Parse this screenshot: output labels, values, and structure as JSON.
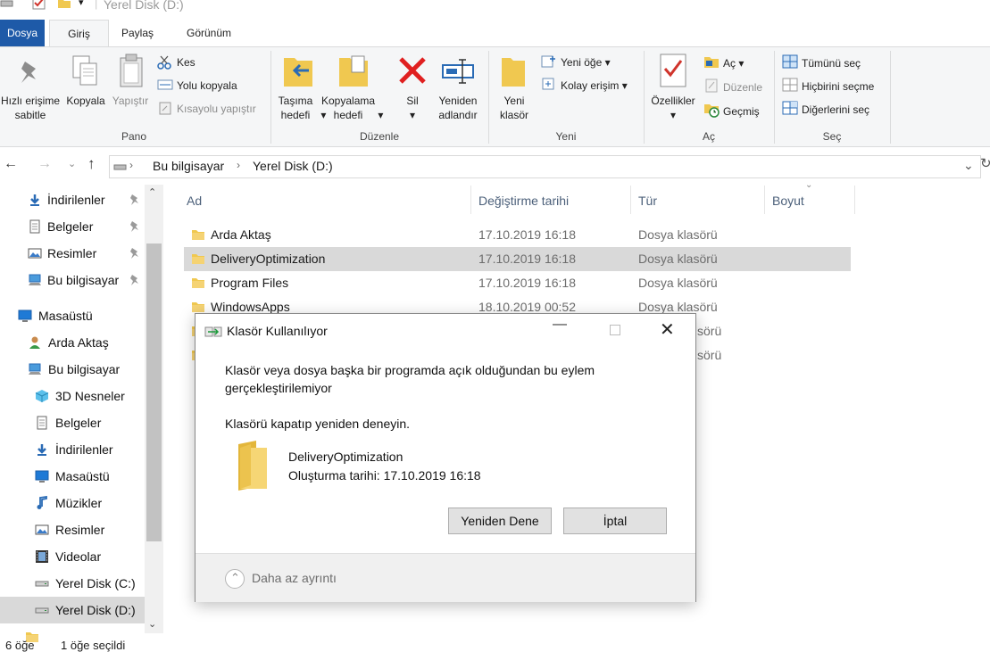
{
  "window": {
    "title": "Yerel Disk (D:)"
  },
  "tabs": [
    "Dosya",
    "Giriş",
    "Paylaş",
    "Görünüm"
  ],
  "ribbon": {
    "pano": {
      "label": "Pano",
      "pin": "Hızlı erişime sabitle",
      "copy": "Kopyala",
      "paste": "Yapıştır",
      "cut": "Kes",
      "copy_path": "Yolu kopyala",
      "paste_shortcut": "Kısayolu yapıştır"
    },
    "duzenle": {
      "label": "Düzenle",
      "move_to": "Taşıma hedefi",
      "copy_to": "Kopyalama hedefi",
      "delete": "Sil",
      "rename": "Yeniden adlandır"
    },
    "yeni": {
      "label": "Yeni",
      "new_folder": "Yeni klasör",
      "new_item": "Yeni öğe",
      "easy_access": "Kolay erişim"
    },
    "ac": {
      "label": "Aç",
      "properties": "Özellikler",
      "open": "Aç",
      "edit": "Düzenle",
      "history": "Geçmiş"
    },
    "sec": {
      "label": "Seç",
      "select_all": "Tümünü seç",
      "select_none": "Hiçbirini seçme",
      "invert": "Diğerlerini seç"
    }
  },
  "address": {
    "crumbs": [
      "Bu bilgisayar",
      "Yerel Disk (D:)"
    ]
  },
  "nav": {
    "quick": [
      {
        "label": "İndirilenler",
        "icon": "download-icon"
      },
      {
        "label": "Belgeler",
        "icon": "document-icon"
      },
      {
        "label": "Resimler",
        "icon": "pictures-icon"
      },
      {
        "label": "Bu bilgisayar",
        "icon": "computer-icon"
      }
    ],
    "tree": [
      {
        "label": "Masaüstü",
        "icon": "desktop-icon",
        "indent": 0
      },
      {
        "label": "Arda Aktaş",
        "icon": "user-icon",
        "indent": 1
      },
      {
        "label": "Bu bilgisayar",
        "icon": "computer-icon",
        "indent": 1
      },
      {
        "label": "3D Nesneler",
        "icon": "3d-objects-icon",
        "indent": 2
      },
      {
        "label": "Belgeler",
        "icon": "document-icon",
        "indent": 2
      },
      {
        "label": "İndirilenler",
        "icon": "download-icon",
        "indent": 2
      },
      {
        "label": "Masaüstü",
        "icon": "desktop-icon",
        "indent": 2
      },
      {
        "label": "Müzikler",
        "icon": "music-icon",
        "indent": 2
      },
      {
        "label": "Resimler",
        "icon": "pictures-icon",
        "indent": 2
      },
      {
        "label": "Videolar",
        "icon": "video-icon",
        "indent": 2
      },
      {
        "label": "Yerel Disk (C:)",
        "icon": "drive-icon",
        "indent": 2
      },
      {
        "label": "Yerel Disk (D:)",
        "icon": "drive-icon",
        "indent": 2,
        "selected": true
      }
    ]
  },
  "columns": [
    "Ad",
    "Değiştirme tarihi",
    "Tür",
    "Boyut"
  ],
  "files": [
    {
      "name": "Arda Aktaş",
      "date": "17.10.2019 16:18",
      "type": "Dosya klasörü"
    },
    {
      "name": "DeliveryOptimization",
      "date": "17.10.2019 16:18",
      "type": "Dosya klasörü",
      "selected": true
    },
    {
      "name": "Program Files",
      "date": "17.10.2019 16:18",
      "type": "Dosya klasörü"
    },
    {
      "name": "WindowsApps",
      "date": "18.10.2019 00:52",
      "type": "Dosya klasörü"
    },
    {
      "name": "",
      "date": "",
      "type": "sörü"
    },
    {
      "name": "",
      "date": "",
      "type": "sörü"
    }
  ],
  "status": {
    "count": "6 öğe",
    "selected": "1 öğe seçildi"
  },
  "dialog": {
    "title": "Klasör Kullanılıyor",
    "message_line1": "Klasör veya dosya başka bir programda açık olduğundan bu eylem",
    "message_line2": "gerçekleştirilemiyor",
    "hint": "Klasörü kapatıp yeniden deneyin.",
    "item_name": "DeliveryOptimization",
    "item_date": "Oluşturma tarihi: 17.10.2019 16:18",
    "retry": "Yeniden Dene",
    "cancel": "İptal",
    "less_details": "Daha az ayrıntı"
  },
  "colors": {
    "accent": "#1e5aa8",
    "selection": "#d9d9d9",
    "folder": "#f0c850"
  }
}
